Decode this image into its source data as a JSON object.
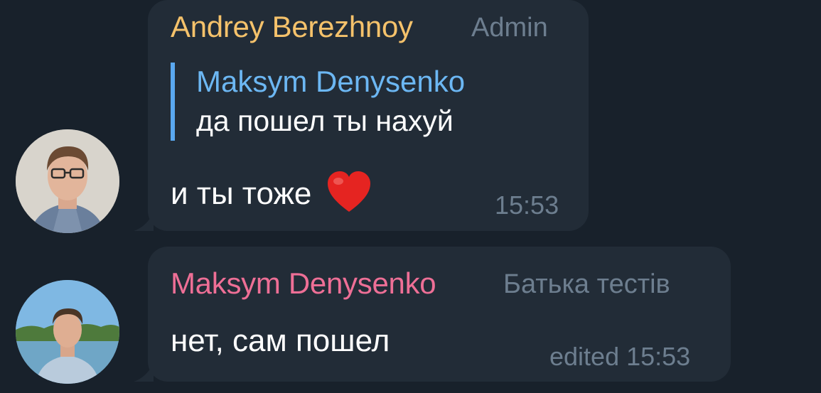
{
  "messages": [
    {
      "sender": "Andrey Berezhnoy",
      "sender_color": "#f5c26b",
      "role": "Admin",
      "reply": {
        "name": "Maksym Denysenko",
        "text": "да пошел ты нахуй"
      },
      "text": "и ты тоже",
      "emoji": "heart-emoji",
      "time": "15:53"
    },
    {
      "sender": "Maksym Denysenko",
      "sender_color": "#ee6f96",
      "role": "Батька тестів",
      "text": "нет, сам пошел",
      "time": "edited 15:53"
    }
  ]
}
